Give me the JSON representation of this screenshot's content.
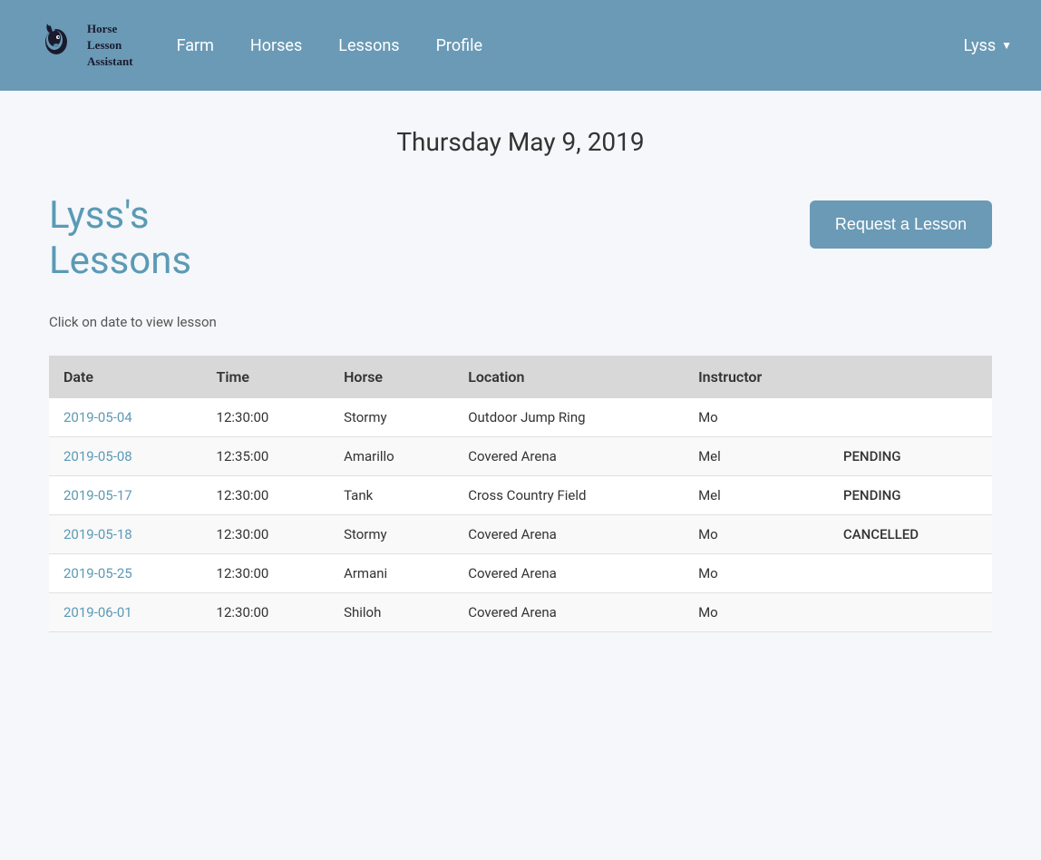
{
  "app": {
    "name_line1": "Horse",
    "name_line2": "Lesson",
    "name_line3": "Assistant"
  },
  "nav": {
    "links": [
      {
        "id": "farm",
        "label": "Farm"
      },
      {
        "id": "horses",
        "label": "Horses"
      },
      {
        "id": "lessons",
        "label": "Lessons"
      },
      {
        "id": "profile",
        "label": "Profile"
      }
    ],
    "user": "Lyss"
  },
  "page": {
    "date": "Thursday May 9, 2019",
    "title_line1": "Lyss's",
    "title_line2": "Lessons",
    "click_hint": "Click on date to view lesson",
    "request_btn": "Request a Lesson"
  },
  "table": {
    "headers": [
      "Date",
      "Time",
      "Horse",
      "Location",
      "Instructor",
      ""
    ],
    "rows": [
      {
        "date": "2019-05-04",
        "time": "12:30:00",
        "horse": "Stormy",
        "location": "Outdoor Jump Ring",
        "instructor": "Mo",
        "status": ""
      },
      {
        "date": "2019-05-08",
        "time": "12:35:00",
        "horse": "Amarillo",
        "location": "Covered Arena",
        "instructor": "Mel",
        "status": "PENDING"
      },
      {
        "date": "2019-05-17",
        "time": "12:30:00",
        "horse": "Tank",
        "location": "Cross Country Field",
        "instructor": "Mel",
        "status": "PENDING"
      },
      {
        "date": "2019-05-18",
        "time": "12:30:00",
        "horse": "Stormy",
        "location": "Covered Arena",
        "instructor": "Mo",
        "status": "CANCELLED"
      },
      {
        "date": "2019-05-25",
        "time": "12:30:00",
        "horse": "Armani",
        "location": "Covered Arena",
        "instructor": "Mo",
        "status": ""
      },
      {
        "date": "2019-06-01",
        "time": "12:30:00",
        "horse": "Shiloh",
        "location": "Covered Arena",
        "instructor": "Mo",
        "status": ""
      }
    ]
  }
}
